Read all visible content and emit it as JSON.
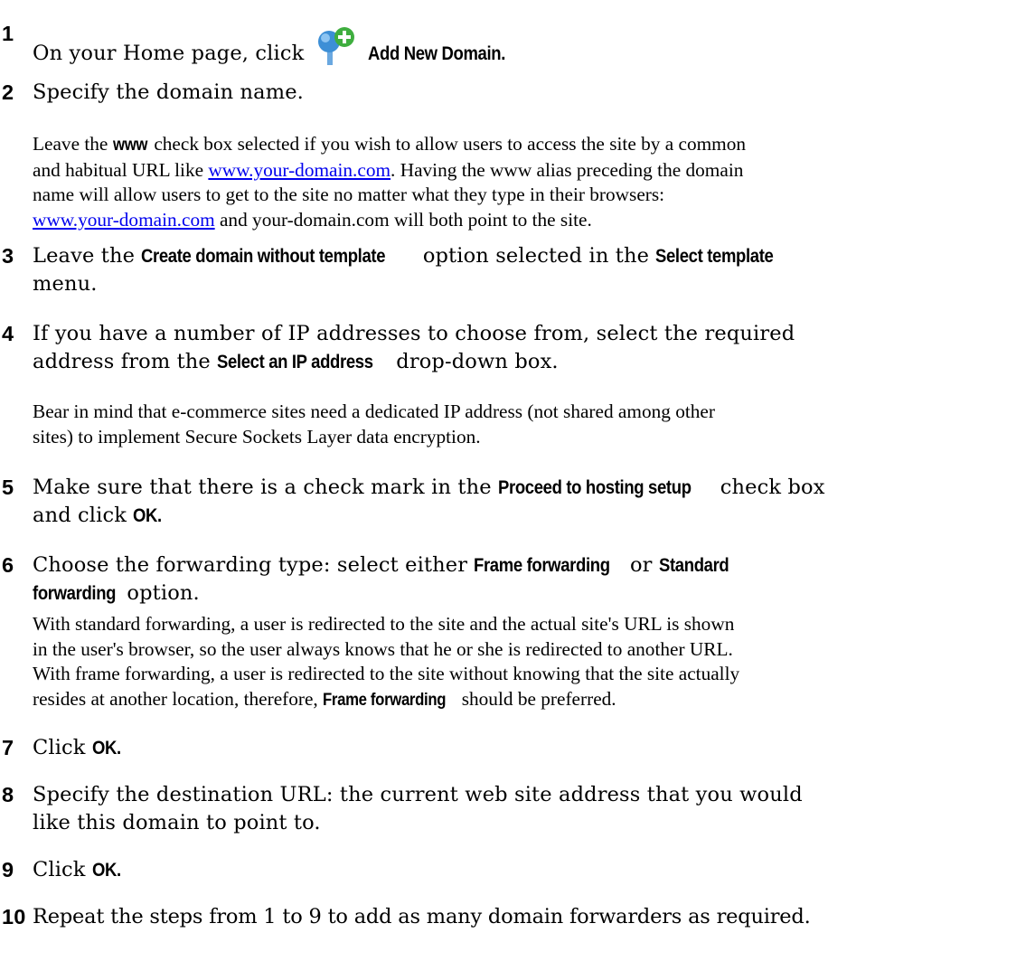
{
  "steps": [
    {
      "num": "1",
      "pre": "On your Home page, click",
      "icon": "add-domain-icon",
      "action": "Add New Domain."
    },
    {
      "num": "2",
      "text": "Specify the domain name."
    },
    {
      "num": "3",
      "pre": "Leave the",
      "ui1": "Create domain without template",
      "mid": "option selected in the",
      "ui2": "Select template",
      "post": "menu."
    },
    {
      "num": "4",
      "line1": "If you have a number of IP addresses to choose from, select the required",
      "pre2": "address from the",
      "ui1": "Select an IP address",
      "post": "drop-down box."
    },
    {
      "num": "5",
      "pre": "Make sure that there is a check mark in the",
      "ui1": "Proceed to hosting setup",
      "mid": "check box",
      "pre2": "and click",
      "ui2": "OK."
    },
    {
      "num": "6",
      "pre": "Choose the forwarding type: select either",
      "ui1": "Frame forwarding",
      "mid": "or",
      "ui2": "Standard",
      "ui3": "forwarding",
      "post": "option."
    },
    {
      "num": "7",
      "pre": "Click",
      "ui1": "OK."
    },
    {
      "num": "8",
      "line1": "Specify the destination URL: the current web site address that you would",
      "line2": "like this domain to point to."
    },
    {
      "num": "9",
      "pre": "Click",
      "ui1": "OK."
    },
    {
      "num": "10",
      "text": "Repeat the steps from 1 to 9 to add as many domain forwarders as required."
    }
  ],
  "notes": {
    "www": {
      "p1": "Leave the",
      "ui": "www",
      "p2": "check box selected if you wish to allow users to access the site by a common",
      "p3": "and habitual URL like",
      "link1": "www.your-domain.com",
      "p4": ". Having the www alias preceding the domain",
      "p5": "name will allow users to get to the site no matter what they type in their browsers:",
      "link2": "www.your-domain.com",
      "p6": "and your-domain.com will both point to the site."
    },
    "ssl": {
      "l1": "Bear in mind that e-commerce sites need a dedicated IP address (not shared among other",
      "l2": "sites) to implement Secure Sockets Layer data encryption."
    },
    "forwarding": {
      "l1": "With standard forwarding, a user is redirected to the site and the actual site's URL is shown",
      "l2": "in the user's browser, so the user always knows that he or she is redirected to another URL.",
      "l3": "With frame forwarding, a user is redirected to the site without knowing that the site actually",
      "l4pre": "resides at another location, therefore,",
      "l4ui": "Frame forwarding",
      "l4post": "should be preferred."
    }
  },
  "colors": {
    "link": "#0000ee",
    "icon_globe": "#3d8fd6",
    "icon_plus": "#3fae3f"
  }
}
